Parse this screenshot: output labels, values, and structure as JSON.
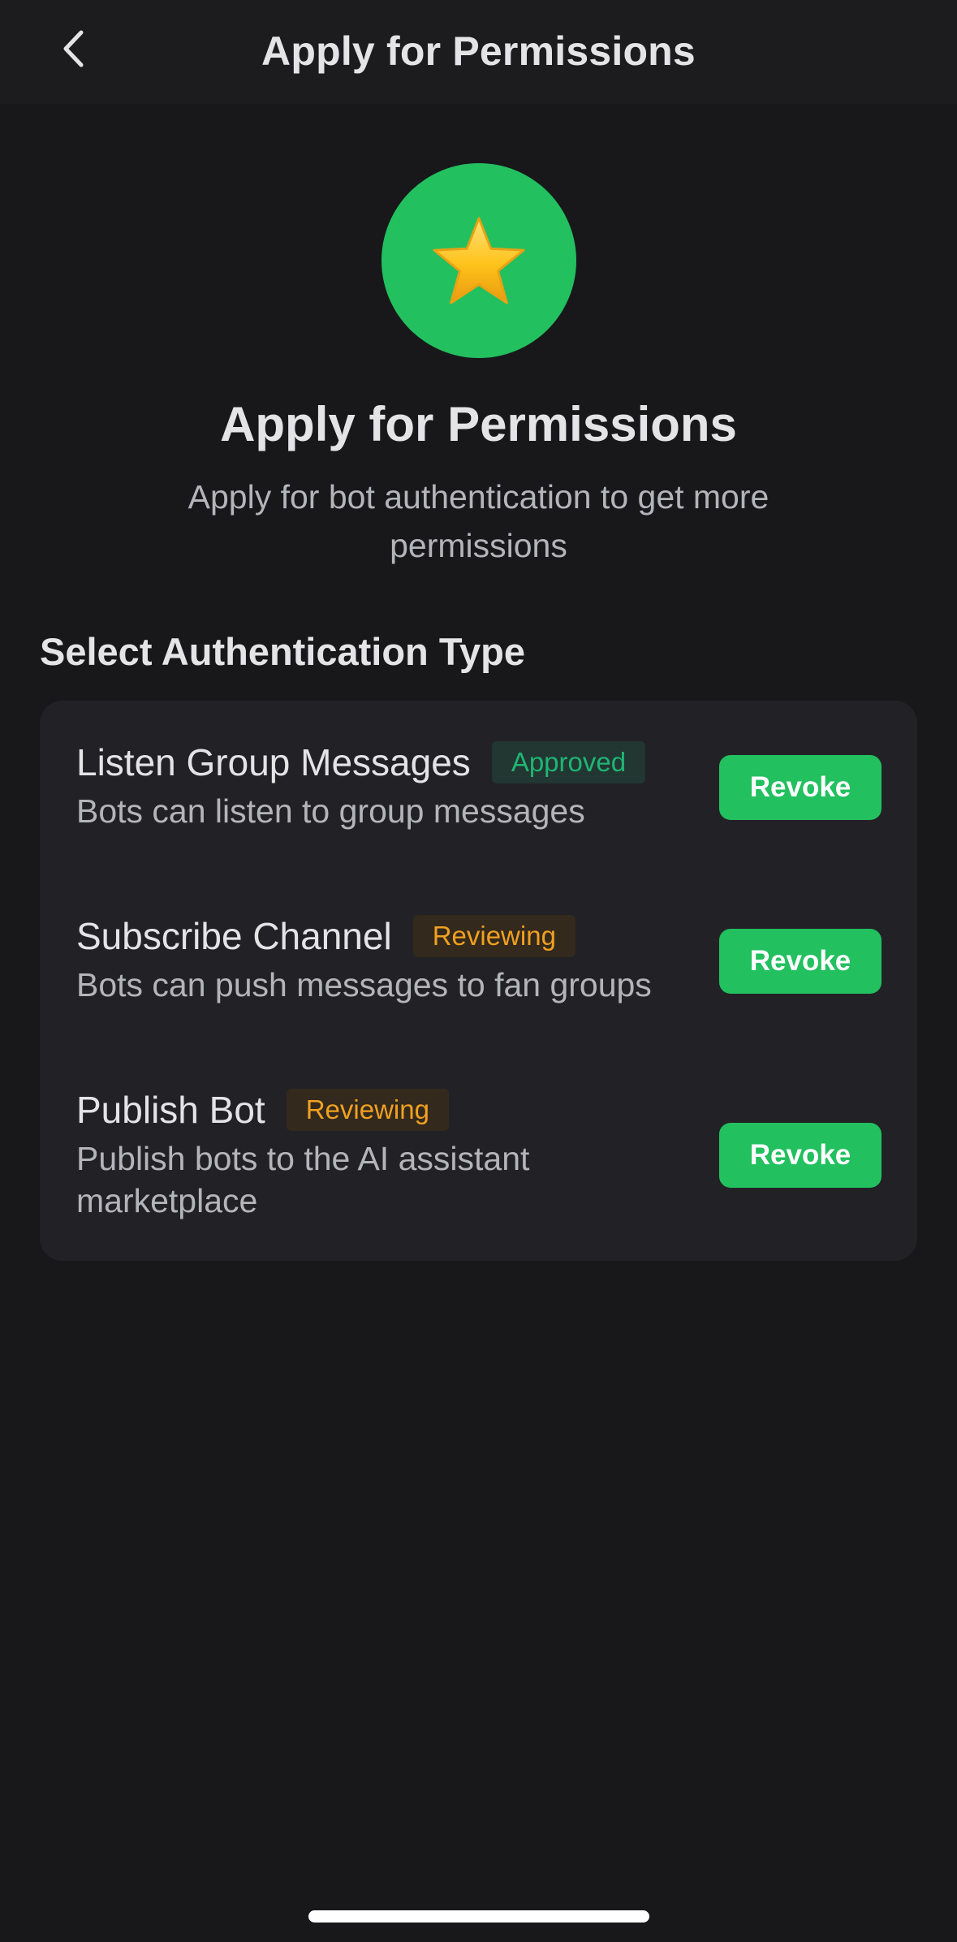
{
  "navbar": {
    "back_icon": "chevron-left-icon",
    "title": "Apply for Permissions"
  },
  "hero": {
    "icon": "star-icon",
    "icon_bg_color": "#22c05f",
    "title": "Apply for Permissions",
    "subtitle": "Apply for bot authentication to get more permissions"
  },
  "section": {
    "title": "Select Authentication Type"
  },
  "permissions": [
    {
      "title": "Listen Group Messages",
      "status": "Approved",
      "description": "Bots can listen to group messages",
      "button_label": "Revoke"
    },
    {
      "title": "Subscribe Channel",
      "status": "Reviewing",
      "description": "Bots can push messages to fan groups",
      "button_label": "Revoke"
    },
    {
      "title": "Publish Bot",
      "status": "Reviewing",
      "description": "Publish bots to the AI assistant marketplace",
      "button_label": "Revoke"
    }
  ],
  "colors": {
    "background": "#18181b",
    "card": "#222226",
    "accent_green": "#22c05f",
    "approved_text": "#1fb574",
    "reviewing_text": "#f0a020"
  }
}
